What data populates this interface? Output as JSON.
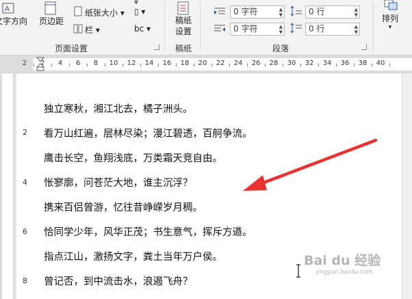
{
  "ribbon": {
    "text_direction": "文字方向",
    "margins": "页边距",
    "paper_size": "纸张大小",
    "columns": "栏",
    "page_setup_label": "页面设置",
    "manuscript_btn_line1": "稿纸",
    "manuscript_btn_line2": "设置",
    "manuscript_label": "稿纸",
    "indent_left_value": "0 字符",
    "indent_right_value": "0 字符",
    "spacing_before_value": "0 行",
    "spacing_after_value": "0 行",
    "paragraph_label": "段落",
    "arrange_label": "排列"
  },
  "ruler": {
    "numbers": [
      "2",
      "2",
      "4",
      "6",
      "8",
      "10",
      "12",
      "14",
      "16",
      "18",
      "20",
      "22",
      "24",
      "26",
      "28",
      "30",
      "32",
      "34",
      "36",
      "38",
      "40"
    ]
  },
  "document": {
    "lines": [
      "独立寒秋，湘江北去，橘子洲头。",
      "看万山红遍，层林尽染；漫江碧透，百舸争流。",
      "鹰击长空，鱼翔浅底，万类霜天竞自由。",
      "怅寥廓，问苍茫大地，谁主沉浮？",
      "携来百侣曾游，忆往昔峥嵘岁月稠。",
      "恰同学少年，风华正茂；书生意气，挥斥方遒。",
      "指点江山，激扬文字，粪土当年万户侯。",
      "曾记否，到中流击水，浪遏飞舟？"
    ],
    "line_numbers": [
      "2",
      "4",
      "6",
      "8"
    ]
  },
  "watermark": {
    "text": "Bai du 经验",
    "sub": "jingyan.baidu.com"
  },
  "colors": {
    "arrow": "#e8322f"
  }
}
